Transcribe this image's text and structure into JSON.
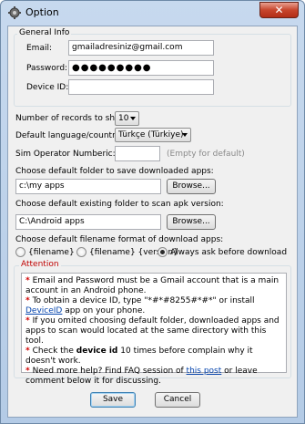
{
  "window": {
    "title": "Option",
    "close_glyph": "✕"
  },
  "general": {
    "legend": "General Info",
    "email_label": "Email:",
    "email_value": "gmailadresiniz@gmail.com",
    "password_label": "Password:",
    "password_value": "●●●●●●●●●",
    "device_label": "Device ID:",
    "device_value": ""
  },
  "records": {
    "label": "Number of records  to show:",
    "value": "10"
  },
  "language": {
    "label": "Default language/country:",
    "value": "Türkçe (Türkiye)"
  },
  "sim": {
    "label": "Sim Operator Numberic:",
    "value": "",
    "hint": "(Empty for default)"
  },
  "download_folder": {
    "label": "Choose default folder to save downloaded apps:",
    "value": "c:\\my apps",
    "browse": "Browse..."
  },
  "scan_folder": {
    "label": "Choose default existing folder to scan apk version:",
    "value": "C:\\Android apps",
    "browse": "Browse..."
  },
  "filename": {
    "label": "Choose default filename format of download apps:",
    "options": [
      "{filename}",
      "{filename} {version}",
      "Always ask before download"
    ],
    "selected": 2
  },
  "attention": {
    "legend": "Attention",
    "bullet": "*",
    "n1": "Email and Password must be a Gmail account that is a main account in an Android phone.",
    "n2_pre": "To obtain a device ID, type \"*#*#8255#*#*\" or install ",
    "n2_link": "DeviceID",
    "n2_post": " app on your phone.",
    "n3": "If you omited choosing default folder, downloaded apps and apps to scan would located at the same directory with this tool.",
    "n4_pre": "Check the ",
    "n4_bold": "device id",
    "n4_post": " 10 times before complain why it doesn't work.",
    "n5_pre": "Need more help? Find FAQ session of ",
    "n5_link": "this post",
    "n5_post": " or leave comment below it for discussing."
  },
  "buttons": {
    "save": "Save",
    "cancel": "Cancel"
  }
}
